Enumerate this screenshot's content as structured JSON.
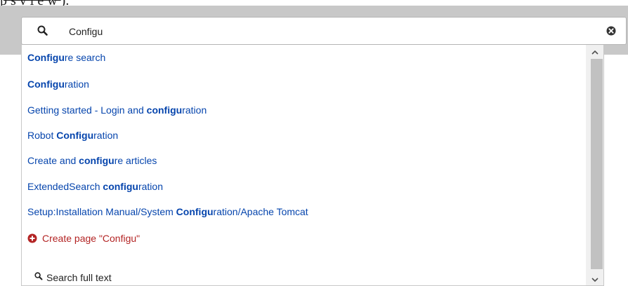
{
  "search": {
    "value": "Configu",
    "placeholder": ""
  },
  "suggestions": [
    {
      "pre": "",
      "match": "Configu",
      "post": "re search"
    },
    {
      "pre": "",
      "match": "Configu",
      "post": "ration"
    },
    {
      "pre": "Getting started - Login and ",
      "match": "configu",
      "post": "ration"
    },
    {
      "pre": "Robot ",
      "match": "Configu",
      "post": "ration"
    },
    {
      "pre": "Create and ",
      "match": "configu",
      "post": "re articles"
    },
    {
      "pre": "ExtendedSearch ",
      "match": "configu",
      "post": "ration"
    },
    {
      "pre": "Setup:Installation Manual/System ",
      "match": "Configu",
      "post": "ration/Apache Tomcat"
    }
  ],
  "create_page": {
    "label": "Create page \"Configu\""
  },
  "fulltext": {
    "label": "Search full text"
  },
  "colors": {
    "link": "#0645ad",
    "create": "#b32424",
    "band": "#c8c8c8"
  },
  "icons": {
    "search": "search-icon",
    "clear": "clear-icon",
    "create": "plus-circle-icon",
    "fulltext": "search-icon",
    "scroll_up": "chevron-up-icon",
    "scroll_down": "chevron-down-icon"
  }
}
